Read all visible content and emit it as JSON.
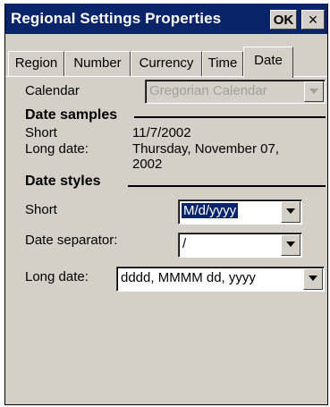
{
  "window": {
    "title": "Regional Settings Properties",
    "ok_label": "OK",
    "close_glyph": "×"
  },
  "tabs": [
    {
      "label": "Region",
      "active": false
    },
    {
      "label": "Number",
      "active": false
    },
    {
      "label": "Currency",
      "active": false
    },
    {
      "label": "Time",
      "active": false
    },
    {
      "label": "Date",
      "active": true
    }
  ],
  "calendar": {
    "label": "Calendar",
    "value": "Gregorian Calendar"
  },
  "date_samples": {
    "heading": "Date samples",
    "short_label": "Short",
    "short_value": "11/7/2002",
    "long_label": "Long date:",
    "long_value_line1": "Thursday, November 07,",
    "long_value_line2": "2002"
  },
  "date_styles": {
    "heading": "Date styles",
    "short_label": "Short",
    "short_value": "M/d/yyyy",
    "separator_label": "Date separator:",
    "separator_value": "/",
    "long_label": "Long date:",
    "long_value": "dddd, MMMM dd, yyyy"
  },
  "colors": {
    "titlebar": "#0a246a",
    "face": "#d4d0c8",
    "selection": "#0a246a"
  },
  "icons": {
    "dropdown": "chevron-down-icon",
    "close": "close-icon"
  }
}
